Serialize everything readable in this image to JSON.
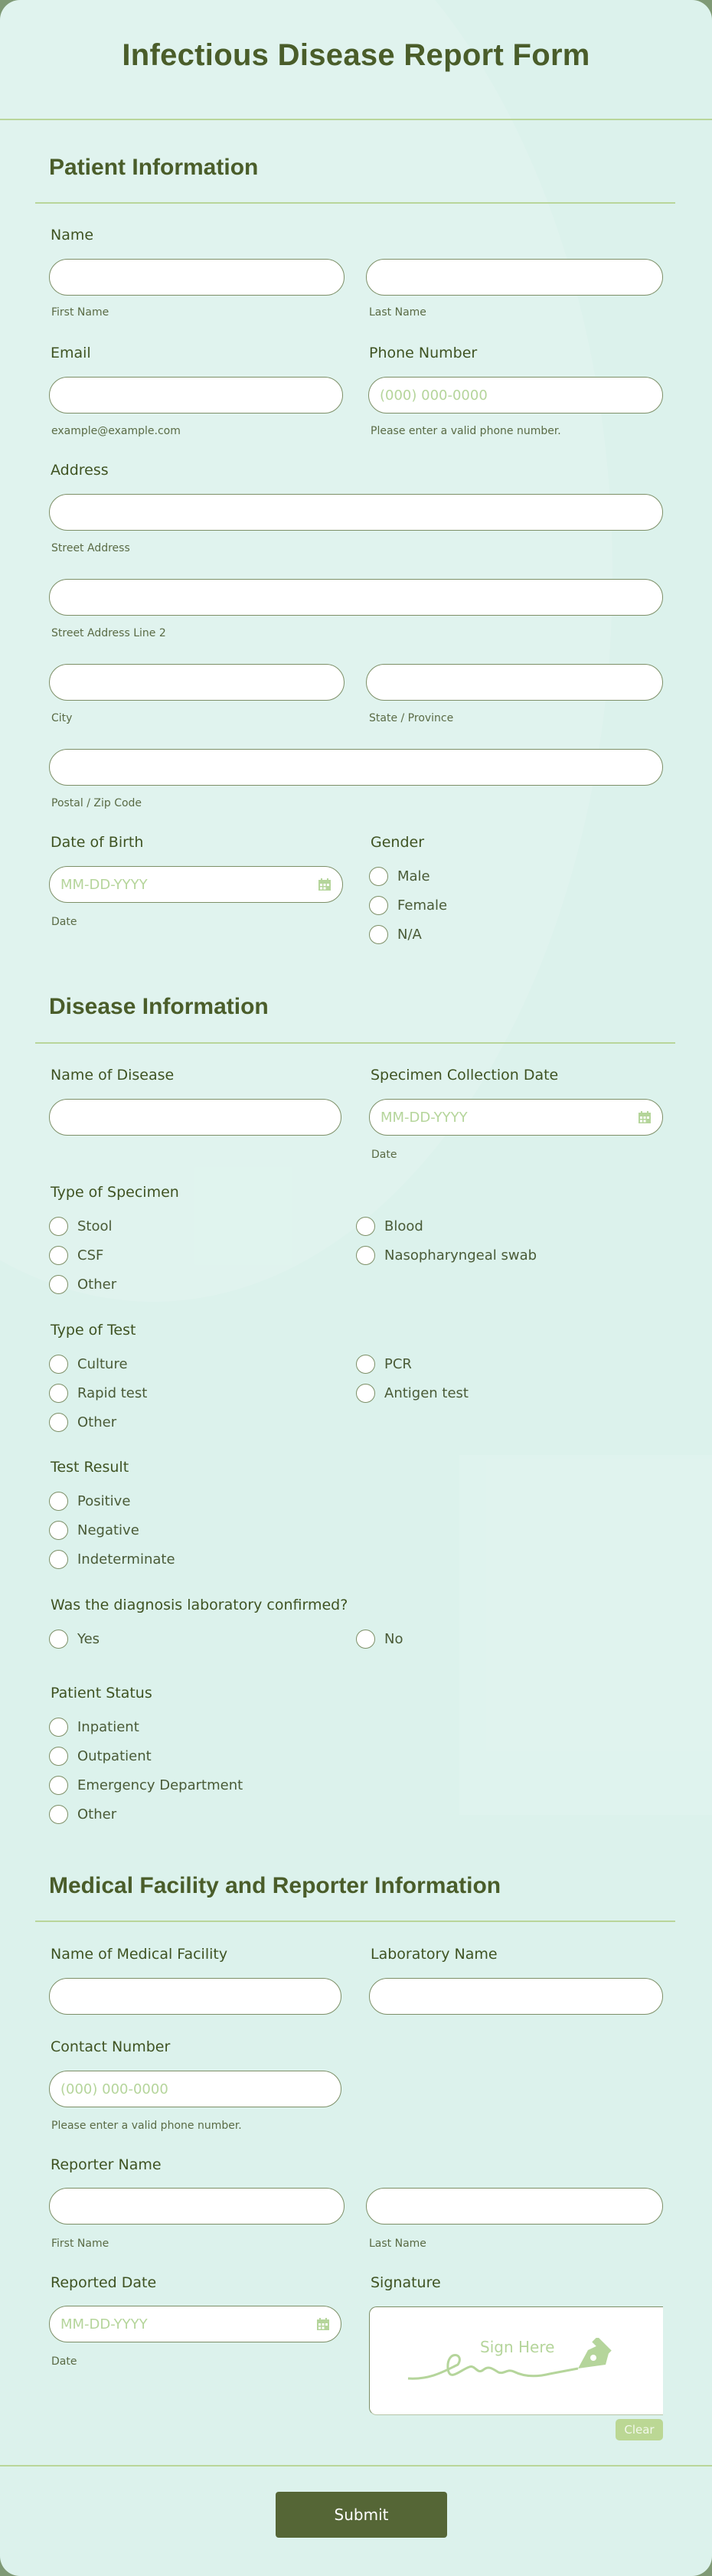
{
  "form": {
    "title": "Infectious Disease Report Form",
    "submit_label": "Submit"
  },
  "patient": {
    "section_title": "Patient Information",
    "name_label": "Name",
    "first_name_sub": "First Name",
    "last_name_sub": "Last Name",
    "email_label": "Email",
    "email_sub": "example@example.com",
    "phone_label": "Phone Number",
    "phone_placeholder": "(000) 000-0000",
    "phone_sub": "Please enter a valid phone number.",
    "address_label": "Address",
    "street_sub": "Street Address",
    "street2_sub": "Street Address Line 2",
    "city_sub": "City",
    "state_sub": "State / Province",
    "zip_sub": "Postal / Zip Code",
    "dob_label": "Date of Birth",
    "dob_placeholder": "MM-DD-YYYY",
    "dob_sub": "Date",
    "gender_label": "Gender",
    "gender_options": [
      "Male",
      "Female",
      "N/A"
    ]
  },
  "disease": {
    "section_title": "Disease Information",
    "disease_name_label": "Name of Disease",
    "collection_date_label": "Specimen Collection Date",
    "collection_date_placeholder": "MM-DD-YYYY",
    "collection_date_sub": "Date",
    "specimen_label": "Type of Specimen",
    "specimen_options": [
      "Stool",
      "Blood",
      "CSF",
      "Nasopharyngeal swab",
      "Other"
    ],
    "test_label": "Type of Test",
    "test_options": [
      "Culture",
      "PCR",
      "Rapid test",
      "Antigen test",
      "Other"
    ],
    "result_label": "Test Result",
    "result_options": [
      "Positive",
      "Negative",
      "Indeterminate"
    ],
    "confirmed_label": "Was the diagnosis laboratory confirmed?",
    "confirmed_options": [
      "Yes",
      "No"
    ],
    "status_label": "Patient Status",
    "status_options": [
      "Inpatient",
      "Outpatient",
      "Emergency Department",
      "Other"
    ]
  },
  "facility": {
    "section_title": "Medical Facility and Reporter Information",
    "facility_label": "Name of Medical Facility",
    "lab_label": "Laboratory Name",
    "contact_label": "Contact Number",
    "contact_placeholder": "(000) 000-0000",
    "contact_sub": "Please enter a valid phone number.",
    "reporter_label": "Reporter Name",
    "reporter_first_sub": "First Name",
    "reporter_last_sub": "Last Name",
    "reported_date_label": "Reported Date",
    "reported_date_placeholder": "MM-DD-YYYY",
    "reported_date_sub": "Date",
    "signature_label": "Signature",
    "signature_hint": "Sign Here",
    "clear_label": "Clear"
  }
}
